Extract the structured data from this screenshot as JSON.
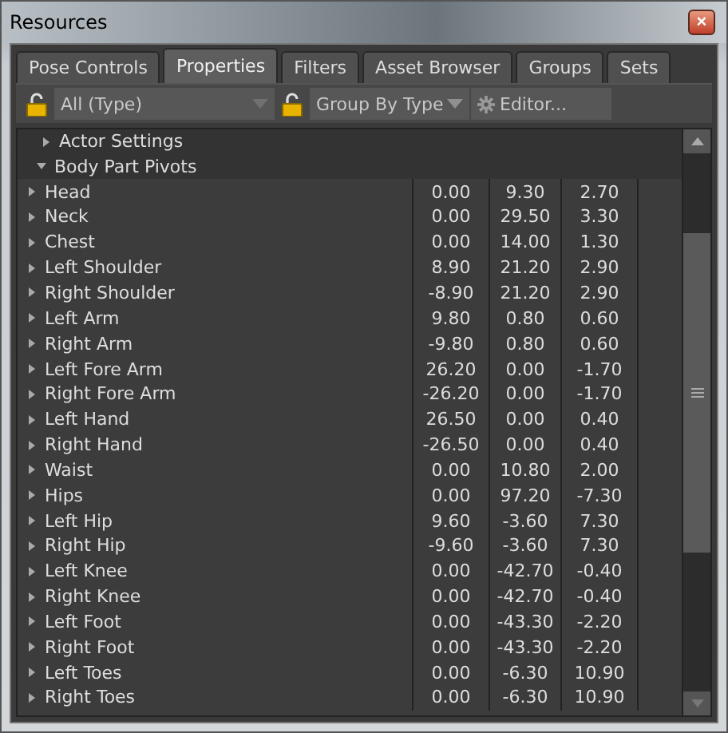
{
  "window": {
    "title": "Resources",
    "close": "×"
  },
  "tabs": [
    {
      "label": "Pose Controls",
      "selected": false
    },
    {
      "label": "Properties",
      "selected": true
    },
    {
      "label": "Filters",
      "selected": false
    },
    {
      "label": "Asset Browser",
      "selected": false
    },
    {
      "label": "Groups",
      "selected": false
    },
    {
      "label": "Sets",
      "selected": false
    }
  ],
  "toolbar": {
    "filter": "All (Type)",
    "grouping": "Group By Type",
    "editor": "Editor..."
  },
  "tree": [
    {
      "label": "Actor Settings",
      "expanded": false
    },
    {
      "label": "Body Part Pivots",
      "expanded": true,
      "children": [
        {
          "label": "Head",
          "expanded": false,
          "values": [
            "0.00",
            "9.30",
            "2.70"
          ]
        },
        {
          "label": "Neck",
          "expanded": false,
          "values": [
            "0.00",
            "29.50",
            "3.30"
          ]
        },
        {
          "label": "Chest",
          "expanded": false,
          "values": [
            "0.00",
            "14.00",
            "1.30"
          ]
        },
        {
          "label": "Left Shoulder",
          "expanded": false,
          "values": [
            "8.90",
            "21.20",
            "2.90"
          ]
        },
        {
          "label": "Right Shoulder",
          "expanded": false,
          "values": [
            "-8.90",
            "21.20",
            "2.90"
          ]
        },
        {
          "label": "Left Arm",
          "expanded": false,
          "values": [
            "9.80",
            "0.80",
            "0.60"
          ]
        },
        {
          "label": "Right Arm",
          "expanded": false,
          "values": [
            "-9.80",
            "0.80",
            "0.60"
          ]
        },
        {
          "label": "Left Fore Arm",
          "expanded": false,
          "values": [
            "26.20",
            "0.00",
            "-1.70"
          ]
        },
        {
          "label": "Right Fore Arm",
          "expanded": false,
          "values": [
            "-26.20",
            "0.00",
            "-1.70"
          ]
        },
        {
          "label": "Left Hand",
          "expanded": false,
          "values": [
            "26.50",
            "0.00",
            "0.40"
          ]
        },
        {
          "label": "Right Hand",
          "expanded": false,
          "values": [
            "-26.50",
            "0.00",
            "0.40"
          ]
        },
        {
          "label": "Waist",
          "expanded": false,
          "values": [
            "0.00",
            "10.80",
            "2.00"
          ]
        },
        {
          "label": "Hips",
          "expanded": false,
          "values": [
            "0.00",
            "97.20",
            "-7.30"
          ]
        },
        {
          "label": "Left Hip",
          "expanded": false,
          "values": [
            "9.60",
            "-3.60",
            "7.30"
          ]
        },
        {
          "label": "Right Hip",
          "expanded": false,
          "values": [
            "-9.60",
            "-3.60",
            "7.30"
          ]
        },
        {
          "label": "Left Knee",
          "expanded": false,
          "values": [
            "0.00",
            "-42.70",
            "-0.40"
          ]
        },
        {
          "label": "Right Knee",
          "expanded": false,
          "values": [
            "0.00",
            "-42.70",
            "-0.40"
          ]
        },
        {
          "label": "Left Foot",
          "expanded": false,
          "values": [
            "0.00",
            "-43.30",
            "-2.20"
          ]
        },
        {
          "label": "Right Foot",
          "expanded": false,
          "values": [
            "0.00",
            "-43.30",
            "-2.20"
          ]
        },
        {
          "label": "Left Toes",
          "expanded": false,
          "values": [
            "0.00",
            "-6.30",
            "10.90"
          ]
        },
        {
          "label": "Right Toes",
          "expanded": false,
          "values": [
            "0.00",
            "-6.30",
            "10.90"
          ]
        }
      ]
    }
  ]
}
